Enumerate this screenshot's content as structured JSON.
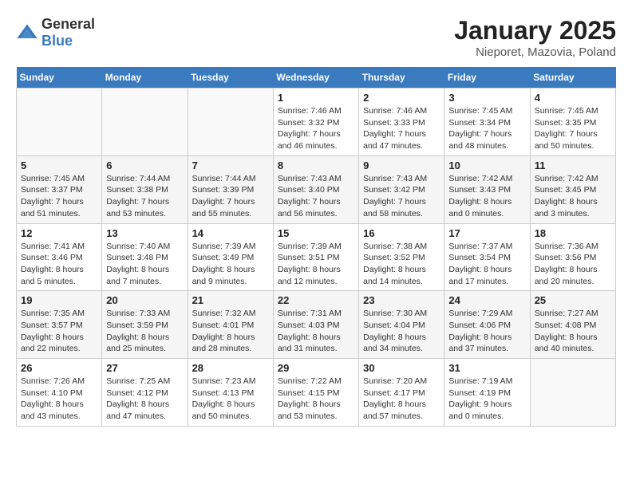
{
  "header": {
    "logo_general": "General",
    "logo_blue": "Blue",
    "title": "January 2025",
    "subtitle": "Nieporet, Mazovia, Poland"
  },
  "weekdays": [
    "Sunday",
    "Monday",
    "Tuesday",
    "Wednesday",
    "Thursday",
    "Friday",
    "Saturday"
  ],
  "weeks": [
    [
      {
        "day": "",
        "info": ""
      },
      {
        "day": "",
        "info": ""
      },
      {
        "day": "",
        "info": ""
      },
      {
        "day": "1",
        "info": "Sunrise: 7:46 AM\nSunset: 3:32 PM\nDaylight: 7 hours and 46 minutes."
      },
      {
        "day": "2",
        "info": "Sunrise: 7:46 AM\nSunset: 3:33 PM\nDaylight: 7 hours and 47 minutes."
      },
      {
        "day": "3",
        "info": "Sunrise: 7:45 AM\nSunset: 3:34 PM\nDaylight: 7 hours and 48 minutes."
      },
      {
        "day": "4",
        "info": "Sunrise: 7:45 AM\nSunset: 3:35 PM\nDaylight: 7 hours and 50 minutes."
      }
    ],
    [
      {
        "day": "5",
        "info": "Sunrise: 7:45 AM\nSunset: 3:37 PM\nDaylight: 7 hours and 51 minutes."
      },
      {
        "day": "6",
        "info": "Sunrise: 7:44 AM\nSunset: 3:38 PM\nDaylight: 7 hours and 53 minutes."
      },
      {
        "day": "7",
        "info": "Sunrise: 7:44 AM\nSunset: 3:39 PM\nDaylight: 7 hours and 55 minutes."
      },
      {
        "day": "8",
        "info": "Sunrise: 7:43 AM\nSunset: 3:40 PM\nDaylight: 7 hours and 56 minutes."
      },
      {
        "day": "9",
        "info": "Sunrise: 7:43 AM\nSunset: 3:42 PM\nDaylight: 7 hours and 58 minutes."
      },
      {
        "day": "10",
        "info": "Sunrise: 7:42 AM\nSunset: 3:43 PM\nDaylight: 8 hours and 0 minutes."
      },
      {
        "day": "11",
        "info": "Sunrise: 7:42 AM\nSunset: 3:45 PM\nDaylight: 8 hours and 3 minutes."
      }
    ],
    [
      {
        "day": "12",
        "info": "Sunrise: 7:41 AM\nSunset: 3:46 PM\nDaylight: 8 hours and 5 minutes."
      },
      {
        "day": "13",
        "info": "Sunrise: 7:40 AM\nSunset: 3:48 PM\nDaylight: 8 hours and 7 minutes."
      },
      {
        "day": "14",
        "info": "Sunrise: 7:39 AM\nSunset: 3:49 PM\nDaylight: 8 hours and 9 minutes."
      },
      {
        "day": "15",
        "info": "Sunrise: 7:39 AM\nSunset: 3:51 PM\nDaylight: 8 hours and 12 minutes."
      },
      {
        "day": "16",
        "info": "Sunrise: 7:38 AM\nSunset: 3:52 PM\nDaylight: 8 hours and 14 minutes."
      },
      {
        "day": "17",
        "info": "Sunrise: 7:37 AM\nSunset: 3:54 PM\nDaylight: 8 hours and 17 minutes."
      },
      {
        "day": "18",
        "info": "Sunrise: 7:36 AM\nSunset: 3:56 PM\nDaylight: 8 hours and 20 minutes."
      }
    ],
    [
      {
        "day": "19",
        "info": "Sunrise: 7:35 AM\nSunset: 3:57 PM\nDaylight: 8 hours and 22 minutes."
      },
      {
        "day": "20",
        "info": "Sunrise: 7:33 AM\nSunset: 3:59 PM\nDaylight: 8 hours and 25 minutes."
      },
      {
        "day": "21",
        "info": "Sunrise: 7:32 AM\nSunset: 4:01 PM\nDaylight: 8 hours and 28 minutes."
      },
      {
        "day": "22",
        "info": "Sunrise: 7:31 AM\nSunset: 4:03 PM\nDaylight: 8 hours and 31 minutes."
      },
      {
        "day": "23",
        "info": "Sunrise: 7:30 AM\nSunset: 4:04 PM\nDaylight: 8 hours and 34 minutes."
      },
      {
        "day": "24",
        "info": "Sunrise: 7:29 AM\nSunset: 4:06 PM\nDaylight: 8 hours and 37 minutes."
      },
      {
        "day": "25",
        "info": "Sunrise: 7:27 AM\nSunset: 4:08 PM\nDaylight: 8 hours and 40 minutes."
      }
    ],
    [
      {
        "day": "26",
        "info": "Sunrise: 7:26 AM\nSunset: 4:10 PM\nDaylight: 8 hours and 43 minutes."
      },
      {
        "day": "27",
        "info": "Sunrise: 7:25 AM\nSunset: 4:12 PM\nDaylight: 8 hours and 47 minutes."
      },
      {
        "day": "28",
        "info": "Sunrise: 7:23 AM\nSunset: 4:13 PM\nDaylight: 8 hours and 50 minutes."
      },
      {
        "day": "29",
        "info": "Sunrise: 7:22 AM\nSunset: 4:15 PM\nDaylight: 8 hours and 53 minutes."
      },
      {
        "day": "30",
        "info": "Sunrise: 7:20 AM\nSunset: 4:17 PM\nDaylight: 8 hours and 57 minutes."
      },
      {
        "day": "31",
        "info": "Sunrise: 7:19 AM\nSunset: 4:19 PM\nDaylight: 9 hours and 0 minutes."
      },
      {
        "day": "",
        "info": ""
      }
    ]
  ]
}
